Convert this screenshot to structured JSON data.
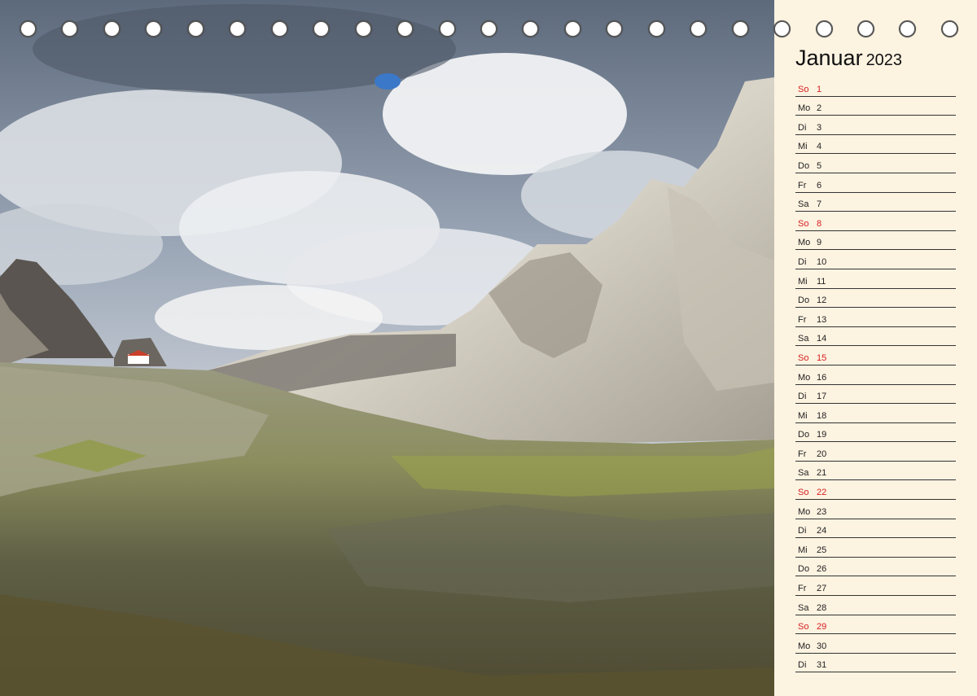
{
  "calendar": {
    "month": "Januar",
    "year": "2023",
    "days": [
      {
        "weekday": "So",
        "day": "1",
        "sunday": true
      },
      {
        "weekday": "Mo",
        "day": "2"
      },
      {
        "weekday": "Di",
        "day": "3"
      },
      {
        "weekday": "Mi",
        "day": "4"
      },
      {
        "weekday": "Do",
        "day": "5"
      },
      {
        "weekday": "Fr",
        "day": "6"
      },
      {
        "weekday": "Sa",
        "day": "7"
      },
      {
        "weekday": "So",
        "day": "8",
        "sunday": true
      },
      {
        "weekday": "Mo",
        "day": "9"
      },
      {
        "weekday": "Di",
        "day": "10"
      },
      {
        "weekday": "Mi",
        "day": "11"
      },
      {
        "weekday": "Do",
        "day": "12"
      },
      {
        "weekday": "Fr",
        "day": "13"
      },
      {
        "weekday": "Sa",
        "day": "14"
      },
      {
        "weekday": "So",
        "day": "15",
        "sunday": true
      },
      {
        "weekday": "Mo",
        "day": "16"
      },
      {
        "weekday": "Di",
        "day": "17"
      },
      {
        "weekday": "Mi",
        "day": "18"
      },
      {
        "weekday": "Do",
        "day": "19"
      },
      {
        "weekday": "Fr",
        "day": "20"
      },
      {
        "weekday": "Sa",
        "day": "21"
      },
      {
        "weekday": "So",
        "day": "22",
        "sunday": true
      },
      {
        "weekday": "Mo",
        "day": "23"
      },
      {
        "weekday": "Di",
        "day": "24"
      },
      {
        "weekday": "Mi",
        "day": "25"
      },
      {
        "weekday": "Do",
        "day": "26"
      },
      {
        "weekday": "Fr",
        "day": "27"
      },
      {
        "weekday": "Sa",
        "day": "28"
      },
      {
        "weekday": "So",
        "day": "29",
        "sunday": true
      },
      {
        "weekday": "Mo",
        "day": "30"
      },
      {
        "weekday": "Di",
        "day": "31"
      }
    ]
  },
  "colors": {
    "panel_background": "#fdf3e1",
    "sunday_text": "#d42020",
    "rule_line": "#333333"
  },
  "photo": {
    "icon": "dolomites-mountain-landscape-photo"
  },
  "binding": {
    "icon": "spiral-binding-ring-icon",
    "ring_count": 23
  }
}
